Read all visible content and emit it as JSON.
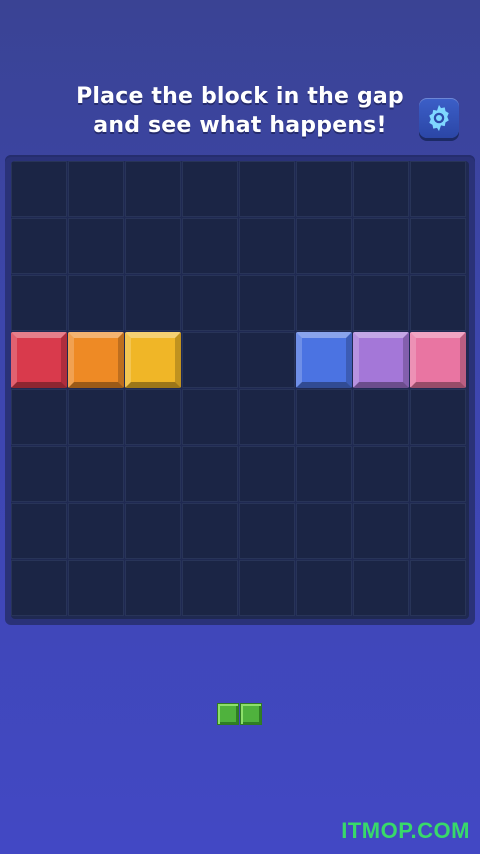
{
  "instruction_line1": "Place the block in the gap",
  "instruction_line2": "and see what happens!",
  "settings_icon": "gear-icon",
  "board": {
    "columns": 8,
    "rows": 8,
    "filled_row_index": 3,
    "blocks": [
      {
        "col": 0,
        "color": "#d93a4c",
        "name": "red"
      },
      {
        "col": 1,
        "color": "#ee8a25",
        "name": "orange"
      },
      {
        "col": 2,
        "color": "#f0b627",
        "name": "yellow"
      },
      {
        "col": 5,
        "color": "#4b73e2",
        "name": "blue"
      },
      {
        "col": 6,
        "color": "#a477d8",
        "name": "purple"
      },
      {
        "col": 7,
        "color": "#e975a2",
        "name": "pink"
      }
    ],
    "gap_columns": [
      3,
      4
    ]
  },
  "next_piece": {
    "color": "#4fb23d",
    "cells": 2,
    "orientation": "horizontal"
  },
  "watermark": "ITMOP.COM"
}
